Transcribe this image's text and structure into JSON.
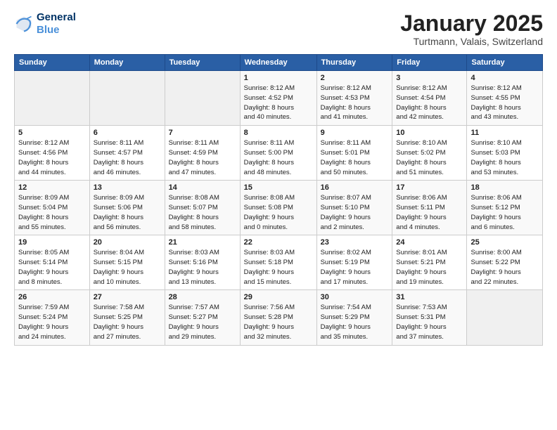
{
  "header": {
    "logo_line1": "General",
    "logo_line2": "Blue",
    "month": "January 2025",
    "location": "Turtmann, Valais, Switzerland"
  },
  "days_of_week": [
    "Sunday",
    "Monday",
    "Tuesday",
    "Wednesday",
    "Thursday",
    "Friday",
    "Saturday"
  ],
  "weeks": [
    [
      {
        "day": "",
        "info": ""
      },
      {
        "day": "",
        "info": ""
      },
      {
        "day": "",
        "info": ""
      },
      {
        "day": "1",
        "info": "Sunrise: 8:12 AM\nSunset: 4:52 PM\nDaylight: 8 hours\nand 40 minutes."
      },
      {
        "day": "2",
        "info": "Sunrise: 8:12 AM\nSunset: 4:53 PM\nDaylight: 8 hours\nand 41 minutes."
      },
      {
        "day": "3",
        "info": "Sunrise: 8:12 AM\nSunset: 4:54 PM\nDaylight: 8 hours\nand 42 minutes."
      },
      {
        "day": "4",
        "info": "Sunrise: 8:12 AM\nSunset: 4:55 PM\nDaylight: 8 hours\nand 43 minutes."
      }
    ],
    [
      {
        "day": "5",
        "info": "Sunrise: 8:12 AM\nSunset: 4:56 PM\nDaylight: 8 hours\nand 44 minutes."
      },
      {
        "day": "6",
        "info": "Sunrise: 8:11 AM\nSunset: 4:57 PM\nDaylight: 8 hours\nand 46 minutes."
      },
      {
        "day": "7",
        "info": "Sunrise: 8:11 AM\nSunset: 4:59 PM\nDaylight: 8 hours\nand 47 minutes."
      },
      {
        "day": "8",
        "info": "Sunrise: 8:11 AM\nSunset: 5:00 PM\nDaylight: 8 hours\nand 48 minutes."
      },
      {
        "day": "9",
        "info": "Sunrise: 8:11 AM\nSunset: 5:01 PM\nDaylight: 8 hours\nand 50 minutes."
      },
      {
        "day": "10",
        "info": "Sunrise: 8:10 AM\nSunset: 5:02 PM\nDaylight: 8 hours\nand 51 minutes."
      },
      {
        "day": "11",
        "info": "Sunrise: 8:10 AM\nSunset: 5:03 PM\nDaylight: 8 hours\nand 53 minutes."
      }
    ],
    [
      {
        "day": "12",
        "info": "Sunrise: 8:09 AM\nSunset: 5:04 PM\nDaylight: 8 hours\nand 55 minutes."
      },
      {
        "day": "13",
        "info": "Sunrise: 8:09 AM\nSunset: 5:06 PM\nDaylight: 8 hours\nand 56 minutes."
      },
      {
        "day": "14",
        "info": "Sunrise: 8:08 AM\nSunset: 5:07 PM\nDaylight: 8 hours\nand 58 minutes."
      },
      {
        "day": "15",
        "info": "Sunrise: 8:08 AM\nSunset: 5:08 PM\nDaylight: 9 hours\nand 0 minutes."
      },
      {
        "day": "16",
        "info": "Sunrise: 8:07 AM\nSunset: 5:10 PM\nDaylight: 9 hours\nand 2 minutes."
      },
      {
        "day": "17",
        "info": "Sunrise: 8:06 AM\nSunset: 5:11 PM\nDaylight: 9 hours\nand 4 minutes."
      },
      {
        "day": "18",
        "info": "Sunrise: 8:06 AM\nSunset: 5:12 PM\nDaylight: 9 hours\nand 6 minutes."
      }
    ],
    [
      {
        "day": "19",
        "info": "Sunrise: 8:05 AM\nSunset: 5:14 PM\nDaylight: 9 hours\nand 8 minutes."
      },
      {
        "day": "20",
        "info": "Sunrise: 8:04 AM\nSunset: 5:15 PM\nDaylight: 9 hours\nand 10 minutes."
      },
      {
        "day": "21",
        "info": "Sunrise: 8:03 AM\nSunset: 5:16 PM\nDaylight: 9 hours\nand 13 minutes."
      },
      {
        "day": "22",
        "info": "Sunrise: 8:03 AM\nSunset: 5:18 PM\nDaylight: 9 hours\nand 15 minutes."
      },
      {
        "day": "23",
        "info": "Sunrise: 8:02 AM\nSunset: 5:19 PM\nDaylight: 9 hours\nand 17 minutes."
      },
      {
        "day": "24",
        "info": "Sunrise: 8:01 AM\nSunset: 5:21 PM\nDaylight: 9 hours\nand 19 minutes."
      },
      {
        "day": "25",
        "info": "Sunrise: 8:00 AM\nSunset: 5:22 PM\nDaylight: 9 hours\nand 22 minutes."
      }
    ],
    [
      {
        "day": "26",
        "info": "Sunrise: 7:59 AM\nSunset: 5:24 PM\nDaylight: 9 hours\nand 24 minutes."
      },
      {
        "day": "27",
        "info": "Sunrise: 7:58 AM\nSunset: 5:25 PM\nDaylight: 9 hours\nand 27 minutes."
      },
      {
        "day": "28",
        "info": "Sunrise: 7:57 AM\nSunset: 5:27 PM\nDaylight: 9 hours\nand 29 minutes."
      },
      {
        "day": "29",
        "info": "Sunrise: 7:56 AM\nSunset: 5:28 PM\nDaylight: 9 hours\nand 32 minutes."
      },
      {
        "day": "30",
        "info": "Sunrise: 7:54 AM\nSunset: 5:29 PM\nDaylight: 9 hours\nand 35 minutes."
      },
      {
        "day": "31",
        "info": "Sunrise: 7:53 AM\nSunset: 5:31 PM\nDaylight: 9 hours\nand 37 minutes."
      },
      {
        "day": "",
        "info": ""
      }
    ]
  ]
}
